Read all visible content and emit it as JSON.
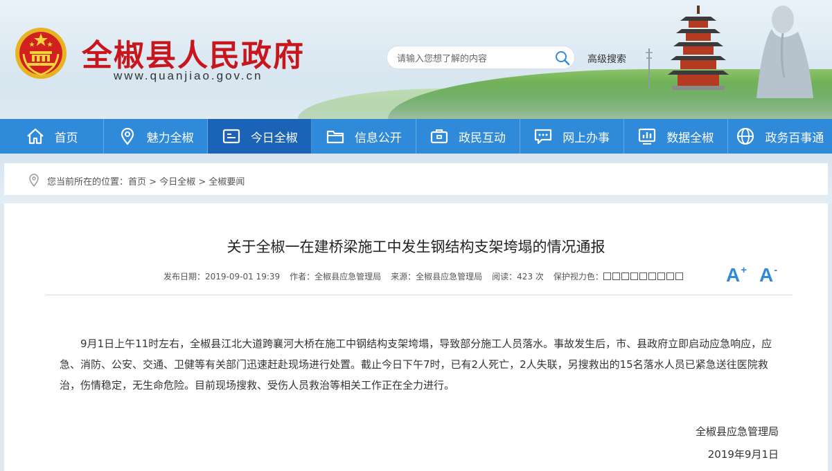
{
  "header": {
    "site_title": "全椒县人民政府",
    "site_url": "www.quanjiao.gov.cn",
    "search_placeholder": "请输入您想了解的内容",
    "advanced_search": "高级搜索"
  },
  "nav": {
    "items": [
      {
        "label": "首页",
        "icon": "home-icon"
      },
      {
        "label": "魅力全椒",
        "icon": "location-pin-icon"
      },
      {
        "label": "今日全椒",
        "icon": "news-card-icon",
        "active": true
      },
      {
        "label": "信息公开",
        "icon": "folder-icon"
      },
      {
        "label": "政民互动",
        "icon": "briefcase-icon"
      },
      {
        "label": "网上办事",
        "icon": "chat-bubble-icon"
      },
      {
        "label": "数据全椒",
        "icon": "bar-chart-icon"
      },
      {
        "label": "政务百事通",
        "icon": "globe-icon"
      }
    ],
    "active_color": "#1a63b7",
    "bar_color": "#2f8ad9"
  },
  "breadcrumb": {
    "prefix": "您当前所在的位置：",
    "items": [
      "首页",
      "今日全椒",
      "全椒要闻"
    ],
    "separator": " > "
  },
  "article": {
    "title": "关于全椒一在建桥梁施工中发生钢结构支架垮塌的情况通报",
    "meta": {
      "publish_date": "发布日期：2019-09-01 19:39",
      "author": "作者：全椒县应急管理局",
      "source": "来源：全椒县应急管理局",
      "reads": "阅读：423 次",
      "eye_protection_label": "保护视力色：",
      "eye_protection_swatches": 9
    },
    "font_increase": "A",
    "font_increase_sup": "+",
    "font_decrease": "A",
    "font_decrease_sup": "-",
    "body": "9月1日上午11时左右，全椒县江北大道跨襄河大桥在施工中钢结构支架垮塌，导致部分施工人员落水。事故发生后，市、县政府立即启动应急响应，应急、消防、公安、交通、卫健等有关部门迅速赶赴现场进行处置。截止今日下午7时，已有2人死亡，2人失联，另搜救出的15名落水人员已紧急送往医院救治，伤情稳定，无生命危险。目前现场搜救、受伤人员救治等相关工作正在全力进行。",
    "signer": "全椒县应急管理局",
    "date": "2019年9月1日"
  }
}
